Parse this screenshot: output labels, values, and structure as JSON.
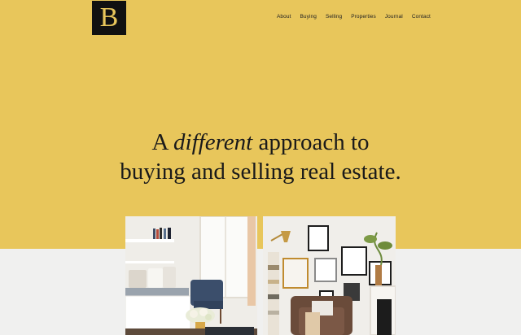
{
  "brand": {
    "logo_letter": "B"
  },
  "nav": {
    "items": [
      "About",
      "Buying",
      "Selling",
      "Properties",
      "Journal",
      "Contact"
    ]
  },
  "hero": {
    "line1_prefix": "A ",
    "line1_emphasis": "different",
    "line1_suffix": " approach to",
    "line2": "buying and selling real estate."
  },
  "colors": {
    "hero_bg": "#e8c65b",
    "page_bg": "#f0f0ef",
    "logo_bg": "#111111",
    "text": "#1a1a1a"
  },
  "photos": [
    {
      "name": "living-room-photo"
    },
    {
      "name": "gallery-wall-photo"
    }
  ]
}
